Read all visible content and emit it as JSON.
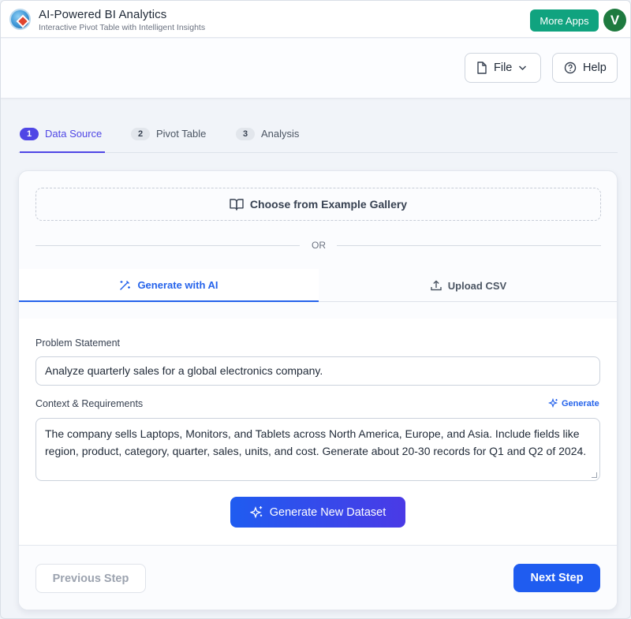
{
  "app": {
    "title": "AI-Powered BI Analytics",
    "subtitle": "Interactive Pivot Table with Intelligent Insights",
    "more_apps_label": "More Apps",
    "avatar_letter": "V",
    "accent_green": "#10a37f"
  },
  "toolbar": {
    "file_label": "File",
    "help_label": "Help"
  },
  "steps": [
    {
      "number": "1",
      "label": "Data Source",
      "active": true
    },
    {
      "number": "2",
      "label": "Pivot Table",
      "active": false
    },
    {
      "number": "3",
      "label": "Analysis",
      "active": false
    }
  ],
  "source": {
    "gallery_label": "Choose from Example Gallery",
    "or_label": "OR",
    "tabs": [
      {
        "label": "Generate with AI",
        "icon": "magic-wand-icon",
        "active": true
      },
      {
        "label": "Upload CSV",
        "icon": "upload-icon",
        "active": false
      }
    ]
  },
  "form": {
    "problem_label": "Problem Statement",
    "problem_value": "Analyze quarterly sales for a global electronics company.",
    "context_label": "Context & Requirements",
    "context_generate_label": "Generate",
    "context_value": "The company sells Laptops, Monitors, and Tablets across North America, Europe, and Asia. Include fields like region, product, category, quarter, sales, units, and cost. Generate about 20-30 records for Q1 and Q2 of 2024.",
    "generate_dataset_label": "Generate New Dataset"
  },
  "footer": {
    "previous_label": "Previous Step",
    "next_label": "Next Step"
  },
  "colors": {
    "primary_blue": "#1f5cf0",
    "step_indigo": "#4f46e5"
  }
}
